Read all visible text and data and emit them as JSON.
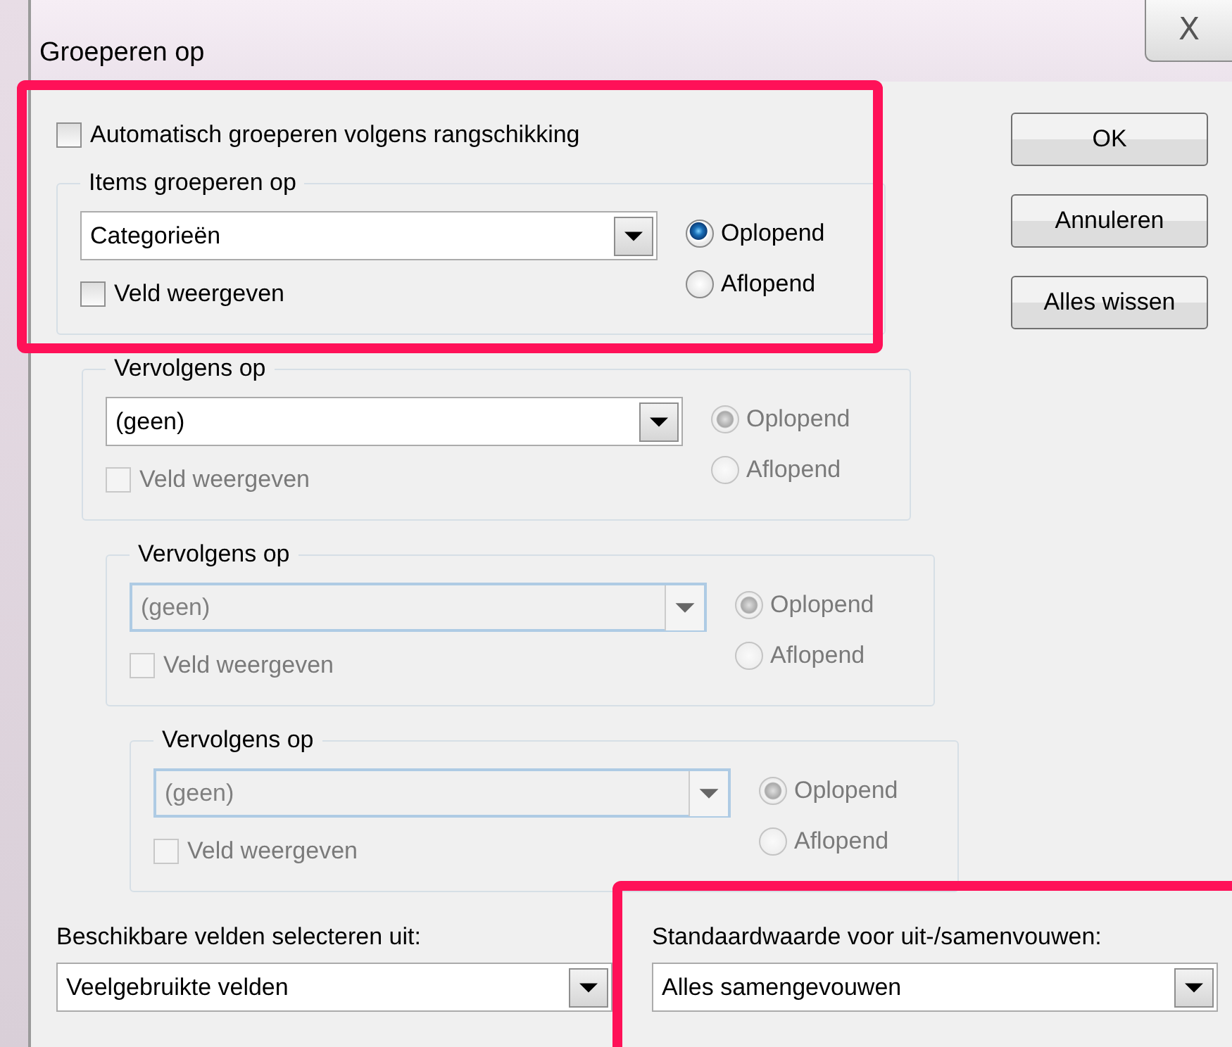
{
  "window": {
    "title": "Groeperen op",
    "close": "X"
  },
  "primary": {
    "highlighted": true,
    "auto_group": {
      "label": "Automatisch groeperen volgens rangschikking",
      "checked": false,
      "disabled": false
    },
    "group": {
      "legend": "Items groeperen op",
      "value": "Categorieën",
      "combo_disabled": false,
      "show_field": {
        "label": "Veld weergeven",
        "checked": false,
        "disabled": false
      },
      "order": [
        {
          "label": "Oplopend",
          "selected": true,
          "disabled": false
        },
        {
          "label": "Aflopend",
          "selected": false,
          "disabled": false
        }
      ]
    }
  },
  "then_groups": [
    {
      "legend": "Vervolgens op",
      "value": "(geen)",
      "combo_disabled": false,
      "show_field": {
        "label": "Veld weergeven",
        "checked": false,
        "disabled": true
      },
      "order": [
        {
          "label": "Oplopend",
          "selected": true,
          "disabled": true
        },
        {
          "label": "Aflopend",
          "selected": false,
          "disabled": true
        }
      ]
    },
    {
      "legend": "Vervolgens op",
      "value": "(geen)",
      "combo_disabled": true,
      "show_field": {
        "label": "Veld weergeven",
        "checked": false,
        "disabled": true
      },
      "order": [
        {
          "label": "Oplopend",
          "selected": true,
          "disabled": true
        },
        {
          "label": "Aflopend",
          "selected": false,
          "disabled": true
        }
      ]
    },
    {
      "legend": "Vervolgens op",
      "value": "(geen)",
      "combo_disabled": true,
      "show_field": {
        "label": "Veld weergeven",
        "checked": false,
        "disabled": true
      },
      "order": [
        {
          "label": "Oplopend",
          "selected": true,
          "disabled": true
        },
        {
          "label": "Aflopend",
          "selected": false,
          "disabled": true
        }
      ]
    }
  ],
  "fields_from": {
    "label": "Beschikbare velden selecteren uit:",
    "value": "Veelgebruikte velden"
  },
  "collapse_default": {
    "label": "Standaardwaarde voor uit-/samenvouwen:",
    "value": "Alles samengevouwen",
    "highlighted": true
  },
  "buttons": [
    "OK",
    "Annuleren",
    "Alles wissen"
  ]
}
